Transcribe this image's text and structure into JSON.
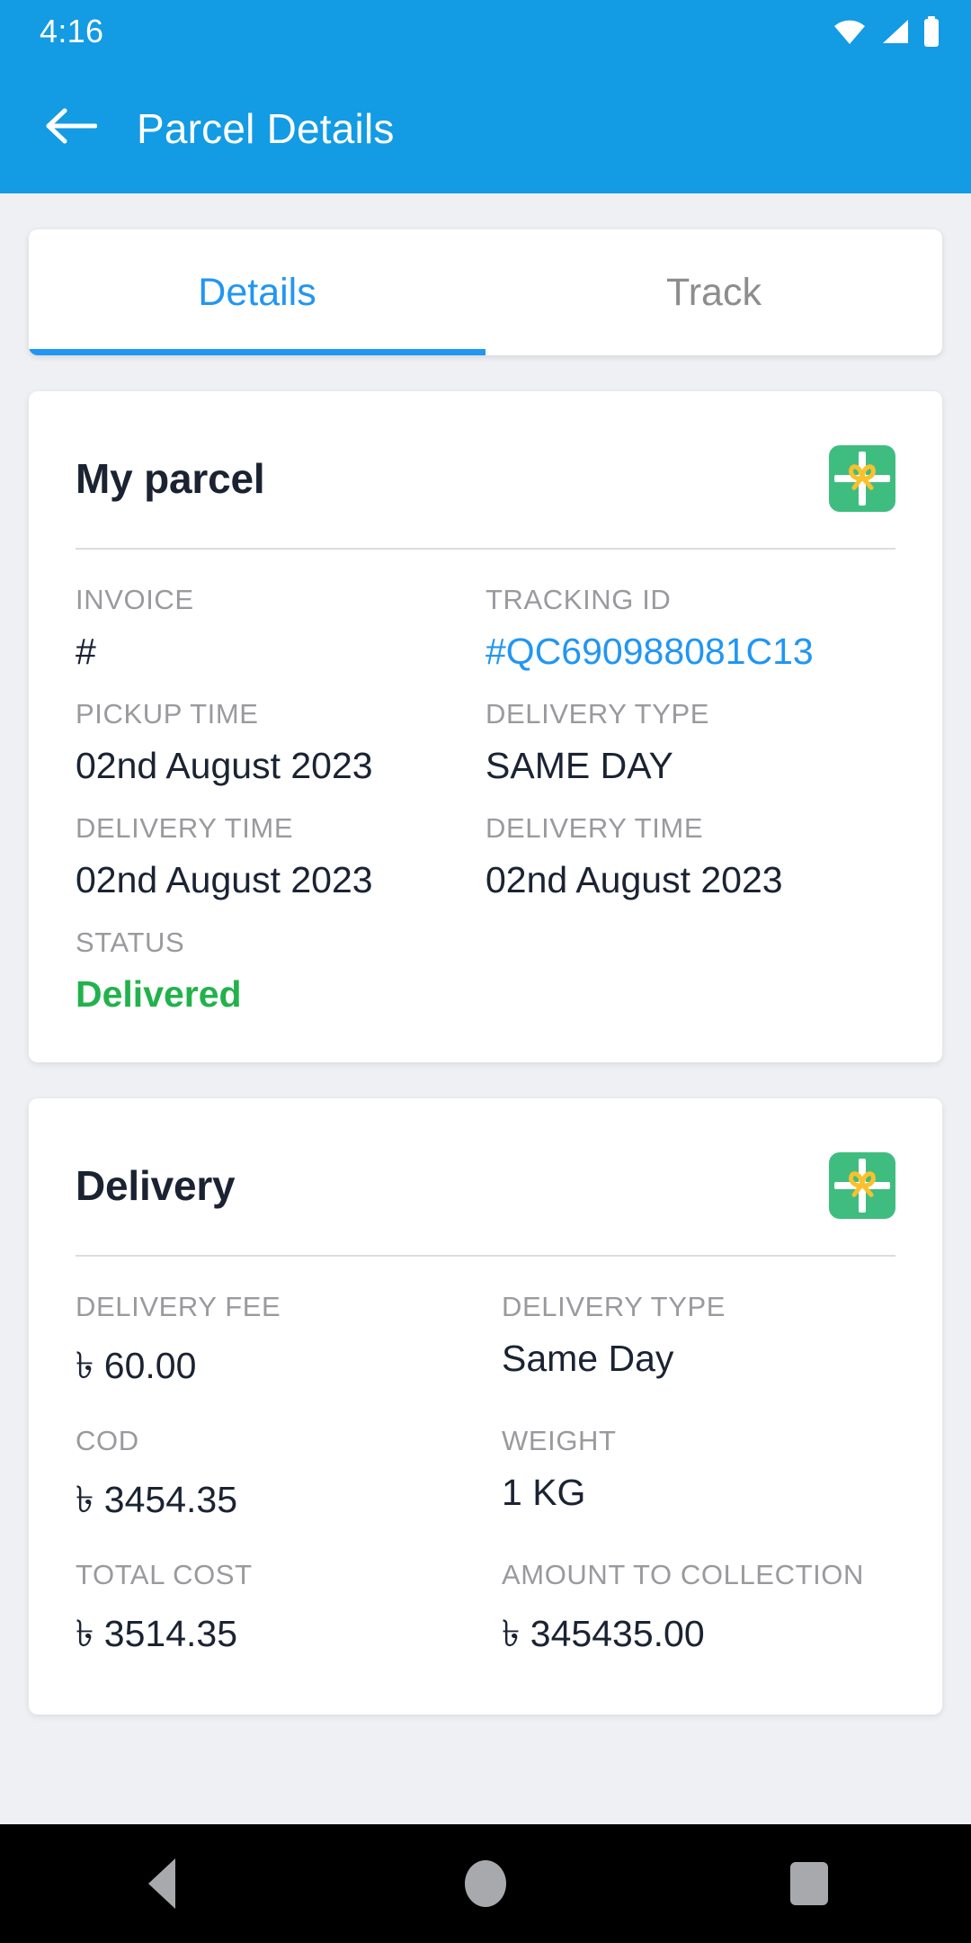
{
  "statusbar": {
    "time": "4:16",
    "icons": [
      "wifi-icon",
      "cellular-signal-icon",
      "battery-icon"
    ]
  },
  "appbar": {
    "back_icon": "arrow-left-icon",
    "title": "Parcel Details",
    "background_color": "#139be4"
  },
  "tabs": [
    {
      "label": "Details",
      "active": true
    },
    {
      "label": "Track",
      "active": false
    }
  ],
  "cards": [
    {
      "title": "My parcel",
      "icon": "gift-icon",
      "rows": [
        [
          {
            "label": "INVOICE",
            "value": "#",
            "style": "normal"
          },
          {
            "label": "TRACKING ID",
            "value": "#QC690988081C13",
            "style": "link"
          }
        ],
        [
          {
            "label": "PICKUP TIME",
            "value": "02nd August 2023",
            "style": "normal"
          },
          {
            "label": "DELIVERY TYPE",
            "value": "SAME DAY",
            "style": "normal"
          }
        ],
        [
          {
            "label": "DELIVERY TIME",
            "value": "02nd August 2023",
            "style": "normal"
          },
          {
            "label": "DELIVERY TIME",
            "value": "02nd August 2023",
            "style": "normal"
          }
        ],
        [
          {
            "label": "STATUS",
            "value": "Delivered",
            "style": "status-ok"
          }
        ]
      ]
    },
    {
      "title": "Delivery",
      "icon": "gift-icon",
      "rows": [
        [
          {
            "label": "DELIVERY FEE",
            "value": "৳ 60.00",
            "style": "normal"
          },
          {
            "label": "DELIVERY TYPE",
            "value": "Same Day",
            "style": "normal"
          }
        ],
        [
          {
            "label": "COD",
            "value": "৳ 3454.35",
            "style": "normal"
          },
          {
            "label": "WEIGHT",
            "value": "1 KG",
            "style": "normal"
          }
        ],
        [
          {
            "label": "TOTAL COST",
            "value": "৳ 3514.35",
            "style": "normal"
          },
          {
            "label": "AMOUNT TO COLLECTION",
            "value": "৳ 345435.00",
            "style": "normal"
          }
        ]
      ]
    }
  ],
  "navbar": {
    "back_label": "back-button",
    "home_label": "home-button",
    "recents_label": "recents-button"
  },
  "colors": {
    "primary": "#139be4",
    "accent": "#2196f3",
    "success": "#22b24c",
    "gift_green": "#3fbd80",
    "gift_bow": "#fbc02d",
    "label_gray": "#9a9a9e",
    "value_dark": "#1b2333",
    "page_bg": "#eef0f3"
  }
}
